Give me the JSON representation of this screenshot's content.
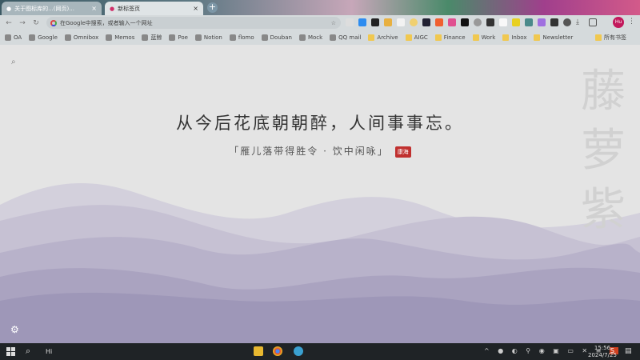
{
  "tabs": [
    {
      "title": "关于图标库的...(网页)...",
      "active": false
    },
    {
      "title": "新标签页",
      "active": true
    }
  ],
  "address": {
    "placeholder": "在Google中搜索，或者输入一个网址"
  },
  "bookmarks": [
    {
      "label": "OA"
    },
    {
      "label": "Google"
    },
    {
      "label": "Omnibox"
    },
    {
      "label": "Memos"
    },
    {
      "label": "蓝鲸"
    },
    {
      "label": "Poe"
    },
    {
      "label": "Notion"
    },
    {
      "label": "flomo"
    },
    {
      "label": "Douban"
    },
    {
      "label": "Mock"
    },
    {
      "label": "QQ mail"
    },
    {
      "label": "Archive",
      "folder": true
    },
    {
      "label": "AIGC",
      "folder": true
    },
    {
      "label": "Finance",
      "folder": true
    },
    {
      "label": "Work",
      "folder": true
    },
    {
      "label": "Inbox",
      "folder": true
    },
    {
      "label": "Newsletter",
      "folder": true
    }
  ],
  "all_bookmarks": "所有书签",
  "profile": "Hu",
  "page": {
    "poem": "从今后花底朝朝醉，人间事事忘。",
    "source": "「雁儿落带得胜令 · 饮中闲咏」",
    "author": "康海",
    "vertical": [
      "藤",
      "萝",
      "紫"
    ],
    "wave_colors": [
      "#d3d0dc",
      "#c6c1d3",
      "#b8b2ca",
      "#aaa3c0",
      "#9e97b8"
    ]
  },
  "taskbar": {
    "search_text": "Hi",
    "time": "15:56",
    "date": "2024/7/25"
  }
}
